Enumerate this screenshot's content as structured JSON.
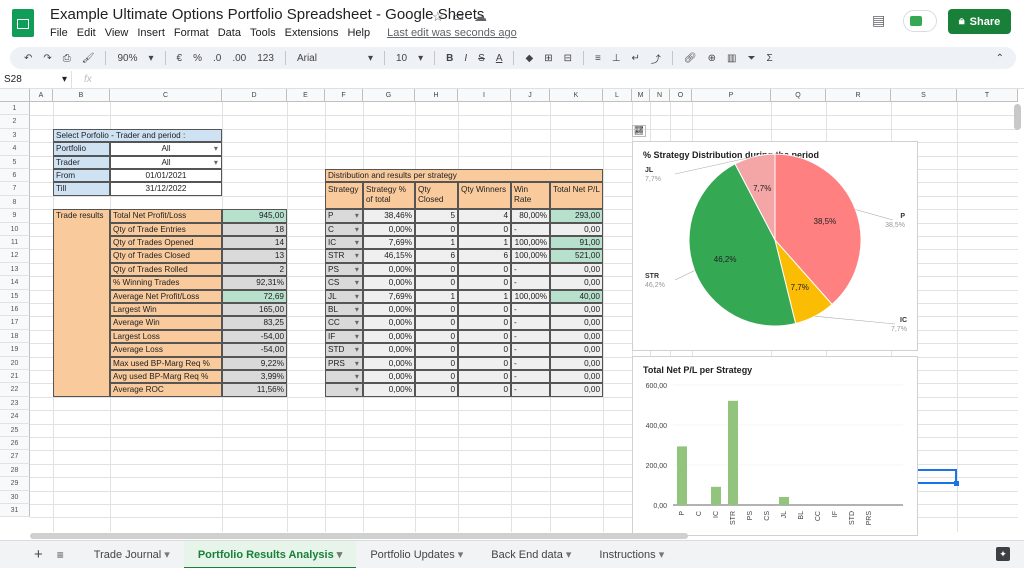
{
  "app": {
    "title": "Example Ultimate Options Portfolio Spreadsheet - Google Sheets",
    "share_label": "Share",
    "last_edit": "Last edit was seconds ago"
  },
  "menu": [
    "File",
    "Edit",
    "View",
    "Insert",
    "Format",
    "Data",
    "Tools",
    "Extensions",
    "Help"
  ],
  "toolbar": {
    "zoom": "90%",
    "currency": "€",
    "percent": "%",
    "dec_less": ".0",
    "dec_more": ".00",
    "number_format": "123",
    "font": "Arial",
    "font_size": "10"
  },
  "namebox": "S28",
  "formula": "",
  "columns": [
    "A",
    "B",
    "C",
    "D",
    "E",
    "F",
    "G",
    "H",
    "I",
    "J",
    "K",
    "L",
    "M",
    "N",
    "O",
    "P",
    "Q",
    "R",
    "S",
    "T"
  ],
  "rows": [
    "1",
    "2",
    "3",
    "4",
    "5",
    "6",
    "7",
    "8",
    "9",
    "10",
    "11",
    "12",
    "13",
    "14",
    "15",
    "16",
    "17",
    "18",
    "19",
    "20",
    "21",
    "22",
    "23",
    "24",
    "25",
    "26",
    "27",
    "28",
    "29",
    "30",
    "31"
  ],
  "select": {
    "header": "Select Porfolio - Trader and period :",
    "rows": [
      [
        "Portfolio",
        "All"
      ],
      [
        "Trader",
        "All"
      ],
      [
        "From",
        "01/01/2021"
      ],
      [
        "Till",
        "31/12/2022"
      ]
    ]
  },
  "trade_results": {
    "label": "Trade results",
    "rows": [
      [
        "Total Net Profit/Loss",
        "945,00"
      ],
      [
        "Qty of Trade Entries",
        "18"
      ],
      [
        "Qty of Trades Opened",
        "14"
      ],
      [
        "Qty of Trades Closed",
        "13"
      ],
      [
        "Qty of Trades Rolled",
        "2"
      ],
      [
        "% Winning Trades",
        "92,31%"
      ],
      [
        "Average Net Profit/Loss",
        "72,69"
      ],
      [
        "Largest Win",
        "165,00"
      ],
      [
        "Average Win",
        "83,25"
      ],
      [
        "Largest Loss",
        "-54,00"
      ],
      [
        "Average Loss",
        "-54,00"
      ],
      [
        "Max used BP-Marg Req %",
        "9,22%"
      ],
      [
        "Avg used BP-Marg Req %",
        "3,99%"
      ],
      [
        "Average ROC",
        "11,56%"
      ]
    ]
  },
  "dist": {
    "title": "Distribution and results per strategy",
    "headers": [
      "Strategy",
      "Strategy % of total",
      "Qty Closed",
      "Qty Winners",
      "Win Rate",
      "Total Net P/L"
    ],
    "rows": [
      [
        "P",
        "38,46%",
        "5",
        "4",
        "80,00%",
        "293,00"
      ],
      [
        "C",
        "0,00%",
        "0",
        "0",
        "-",
        "0,00"
      ],
      [
        "IC",
        "7,69%",
        "1",
        "1",
        "100,00%",
        "91,00"
      ],
      [
        "STR",
        "46,15%",
        "6",
        "6",
        "100,00%",
        "521,00"
      ],
      [
        "PS",
        "0,00%",
        "0",
        "0",
        "-",
        "0,00"
      ],
      [
        "CS",
        "0,00%",
        "0",
        "0",
        "-",
        "0,00"
      ],
      [
        "JL",
        "7,69%",
        "1",
        "1",
        "100,00%",
        "40,00"
      ],
      [
        "BL",
        "0,00%",
        "0",
        "0",
        "-",
        "0,00"
      ],
      [
        "CC",
        "0,00%",
        "0",
        "0",
        "-",
        "0,00"
      ],
      [
        "IF",
        "0,00%",
        "0",
        "0",
        "-",
        "0,00"
      ],
      [
        "STD",
        "0,00%",
        "0",
        "0",
        "-",
        "0,00"
      ],
      [
        "PRS",
        "0,00%",
        "0",
        "0",
        "-",
        "0,00"
      ],
      [
        "",
        "0,00%",
        "0",
        "0",
        "-",
        "0,00"
      ],
      [
        "",
        "0,00%",
        "0",
        "0",
        "-",
        "0,00"
      ]
    ]
  },
  "colors": {
    "green": "#b7e1cd",
    "orange": "#f9cb9c",
    "blue": "#cfe2f3",
    "grey": "#d9d9d9",
    "light": "#efefef",
    "accent": "#188038"
  },
  "chart_data": [
    {
      "type": "pie",
      "title": "% Strategy Distribution during the period",
      "slices": [
        {
          "label": "P",
          "value": 38.5,
          "pct": "38,5%",
          "color": "#ff8080"
        },
        {
          "label": "IC",
          "value": 7.7,
          "pct": "7,7%",
          "color": "#fbbc04"
        },
        {
          "label": "STR",
          "value": 46.2,
          "pct": "46,2%",
          "color": "#34a853"
        },
        {
          "label": "JL",
          "value": 7.7,
          "pct": "7,7%",
          "color": "#f4a6a6"
        }
      ]
    },
    {
      "type": "bar",
      "title": "Total Net P/L per Strategy",
      "categories": [
        "P",
        "C",
        "IC",
        "STR",
        "PS",
        "CS",
        "JL",
        "BL",
        "CC",
        "IF",
        "STD",
        "PRS"
      ],
      "values": [
        293,
        0,
        91,
        521,
        0,
        0,
        40,
        0,
        0,
        0,
        0,
        0
      ],
      "yticks": [
        "0,00",
        "200,00",
        "400,00",
        "600,00"
      ],
      "ylim": [
        0,
        600
      ],
      "color": "#93c47d"
    }
  ],
  "sheets": [
    "Trade Journal",
    "Portfolio Results Analysis",
    "Portfolio Updates",
    "Back End data",
    "Instructions"
  ],
  "active_sheet": 1
}
